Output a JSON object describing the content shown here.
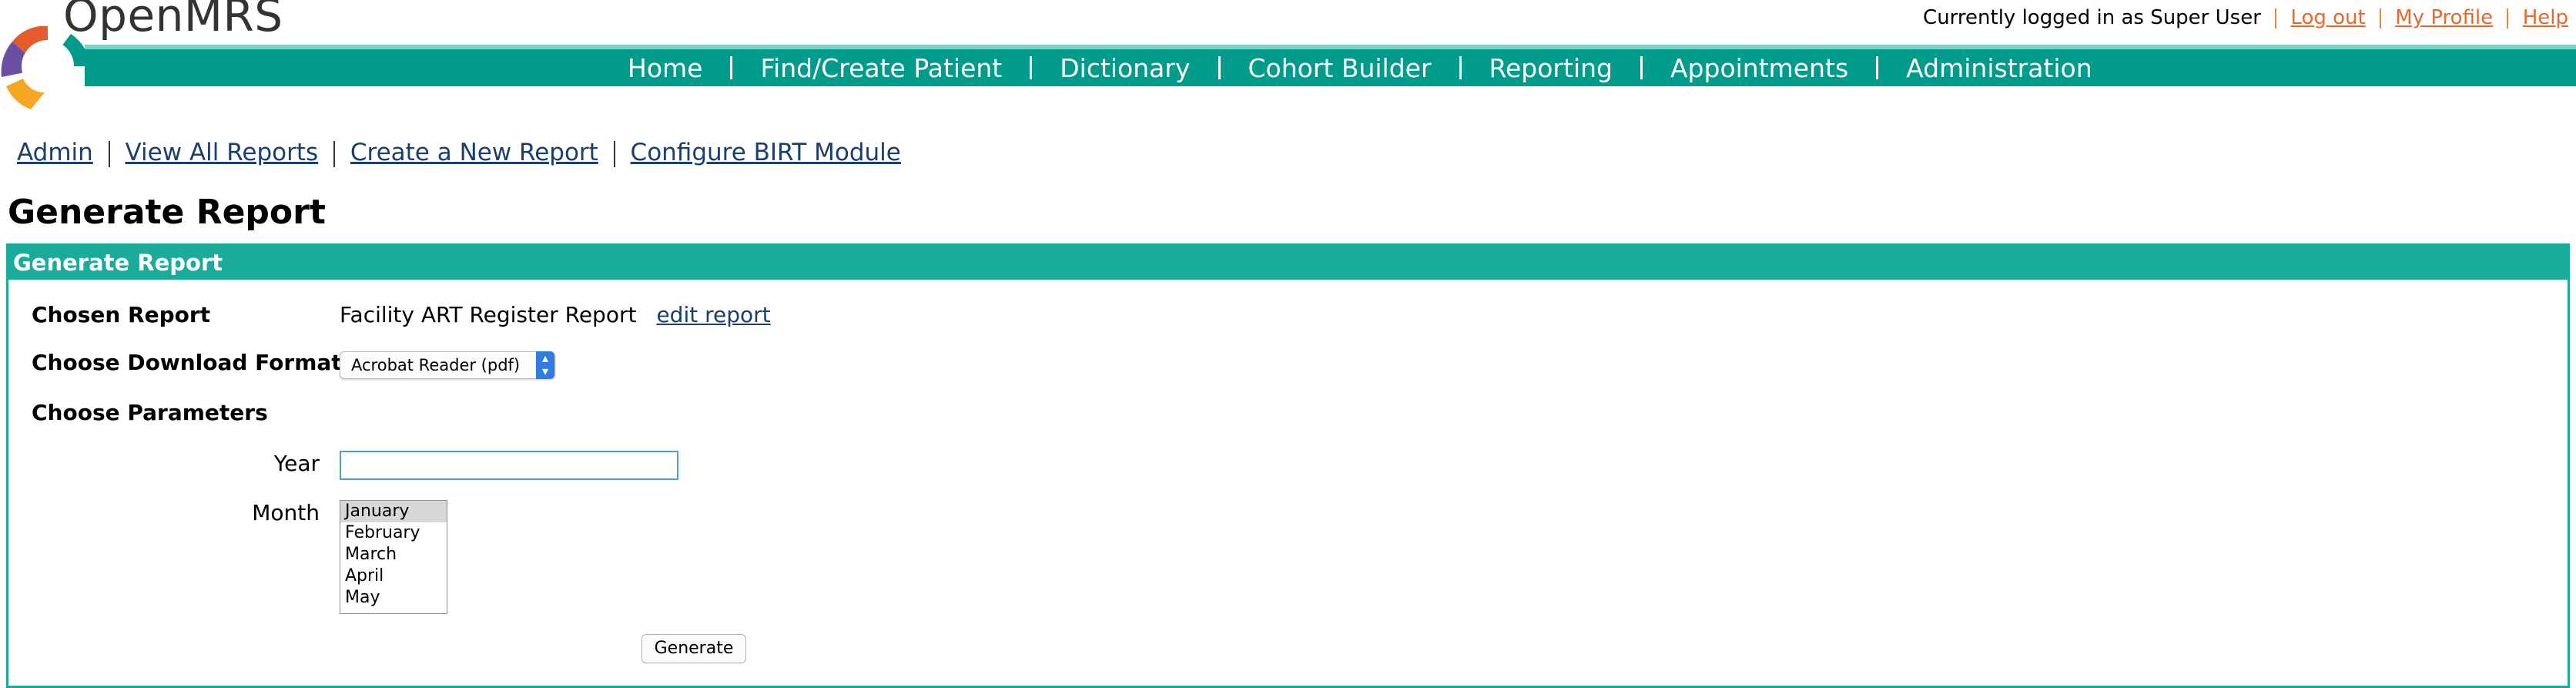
{
  "brand": {
    "name": "OpenMRS",
    "colors": {
      "primary": "#009b8a",
      "header_box": "#1aab9b",
      "link": "#1a3e6e",
      "user_link": "#e9692c"
    }
  },
  "user_bar": {
    "status": "Currently logged in as Super User",
    "links": [
      "Log out",
      "My Profile",
      "Help"
    ]
  },
  "nav": {
    "items": [
      "Home",
      "Find/Create Patient",
      "Dictionary",
      "Cohort Builder",
      "Reporting",
      "Appointments",
      "Administration"
    ]
  },
  "breadcrumbs": [
    "Admin",
    "View All Reports",
    "Create a New Report",
    "Configure BIRT Module"
  ],
  "page_title": "Generate Report",
  "panel": {
    "header": "Generate Report",
    "chosen_report_label": "Chosen Report",
    "chosen_report_value": "Facility ART Register Report",
    "edit_link": "edit report",
    "format_label": "Choose Download Format",
    "format_selected": "Acrobat Reader (pdf)",
    "parameters_label": "Choose Parameters",
    "year_label": "Year",
    "year_value": "",
    "month_label": "Month",
    "month_options": [
      "January",
      "February",
      "March",
      "April",
      "May"
    ],
    "month_selected": "January",
    "generate_label": "Generate"
  }
}
